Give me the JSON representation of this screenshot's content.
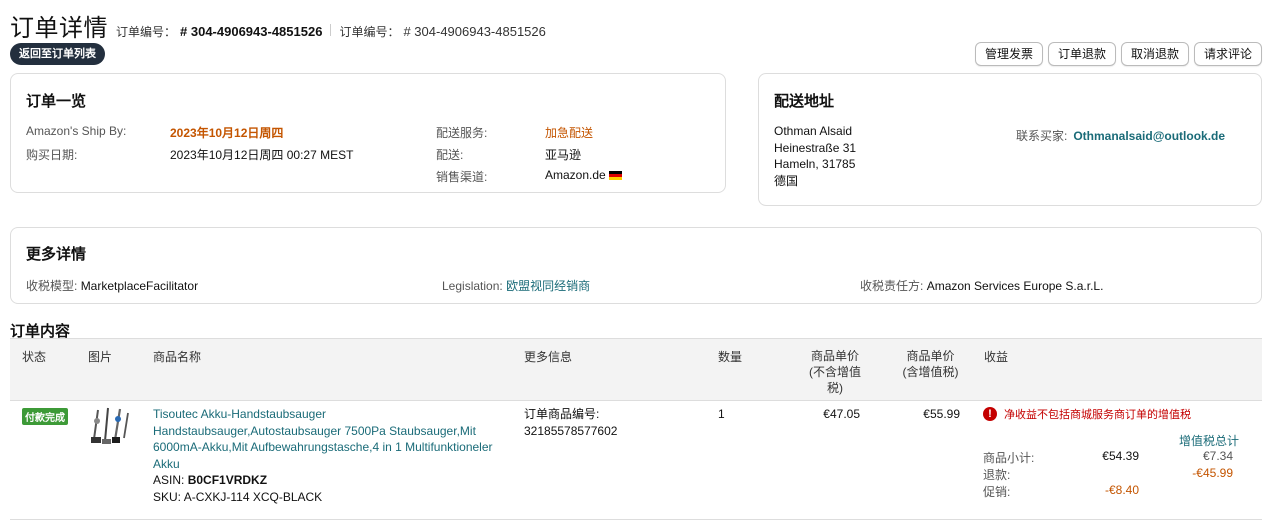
{
  "header": {
    "title": "订单详情",
    "order_label_1": "订单编号：",
    "order_number_1": "# 304-4906943-4851526",
    "order_label_2": "订单编号：",
    "order_number_2": "# 304-4906943-4851526"
  },
  "back_button": "返回至订单列表",
  "actions": [
    "管理发票",
    "订单退款",
    "取消退款",
    "请求评论"
  ],
  "summary": {
    "title": "订单一览",
    "ship_by_label": "Amazon's Ship By:",
    "ship_by_value": "2023年10月12日周四",
    "purchase_date_label": "购买日期:",
    "purchase_date_value": "2023年10月12日周四 00:27 MEST",
    "shipping_service_label": "配送服务:",
    "shipping_service_value": "加急配送",
    "fulfillment_label": "配送:",
    "fulfillment_value": "亚马逊",
    "sales_channel_label": "销售渠道:",
    "sales_channel_value": "Amazon.de"
  },
  "address": {
    "title": "配送地址",
    "name": "Othman Alsaid",
    "street": "Heinestraße 31",
    "city": "Hameln, 31785",
    "country": "德国",
    "contact_label": "联系买家:",
    "contact_email": "Othmanalsaid@outlook.de"
  },
  "more_details": {
    "title": "更多详情",
    "tax_model_label": "收税模型:",
    "tax_model_value": "MarketplaceFacilitator",
    "legislation_label": "Legislation:",
    "legislation_value": "欧盟视同经销商",
    "tax_party_label": "收税责任方:",
    "tax_party_value": "Amazon Services Europe S.a.r.L."
  },
  "contents": {
    "title": "订单内容",
    "columns": {
      "status": "状态",
      "image": "图片",
      "product_name": "商品名称",
      "more_info": "更多信息",
      "quantity": "数量",
      "unit_price_ex_line1": "商品单价",
      "unit_price_ex_line2": "(不含增值",
      "unit_price_ex_line3": "税)",
      "unit_price_inc_line1": "商品单价",
      "unit_price_inc_line2": "(含增值税)",
      "revenue": "收益"
    },
    "row": {
      "status": "付款完成",
      "product_name": "Tisoutec Akku-Handstaubsauger Handstaubsauger,Autostaubsauger 7500Pa Staubsauger,Mit 6000mA-Akku,Mit Aufbewahrungstasche,4 in 1 Multifunktioneler Akku",
      "asin_label": "ASIN:",
      "asin": "B0CF1VRDKZ",
      "sku_label": "SKU:",
      "sku": "A-CXKJ-114 XCQ-BLACK",
      "order_item_label": "订单商品编号:",
      "order_item_id": "32185578577602",
      "quantity": "1",
      "unit_price_ex": "€47.05",
      "unit_price_inc": "€55.99",
      "revenue_warning": "净收益不包括商城服务商订单的增值税",
      "vat_total_label": "增值税总计",
      "subtotal_label": "商品小计:",
      "subtotal_value": "€54.39",
      "subtotal_vat": "€7.34",
      "refund_label": "退款:",
      "refund_vat": "-€45.99",
      "promo_label": "促销:",
      "promo_value": "-€8.40"
    }
  }
}
